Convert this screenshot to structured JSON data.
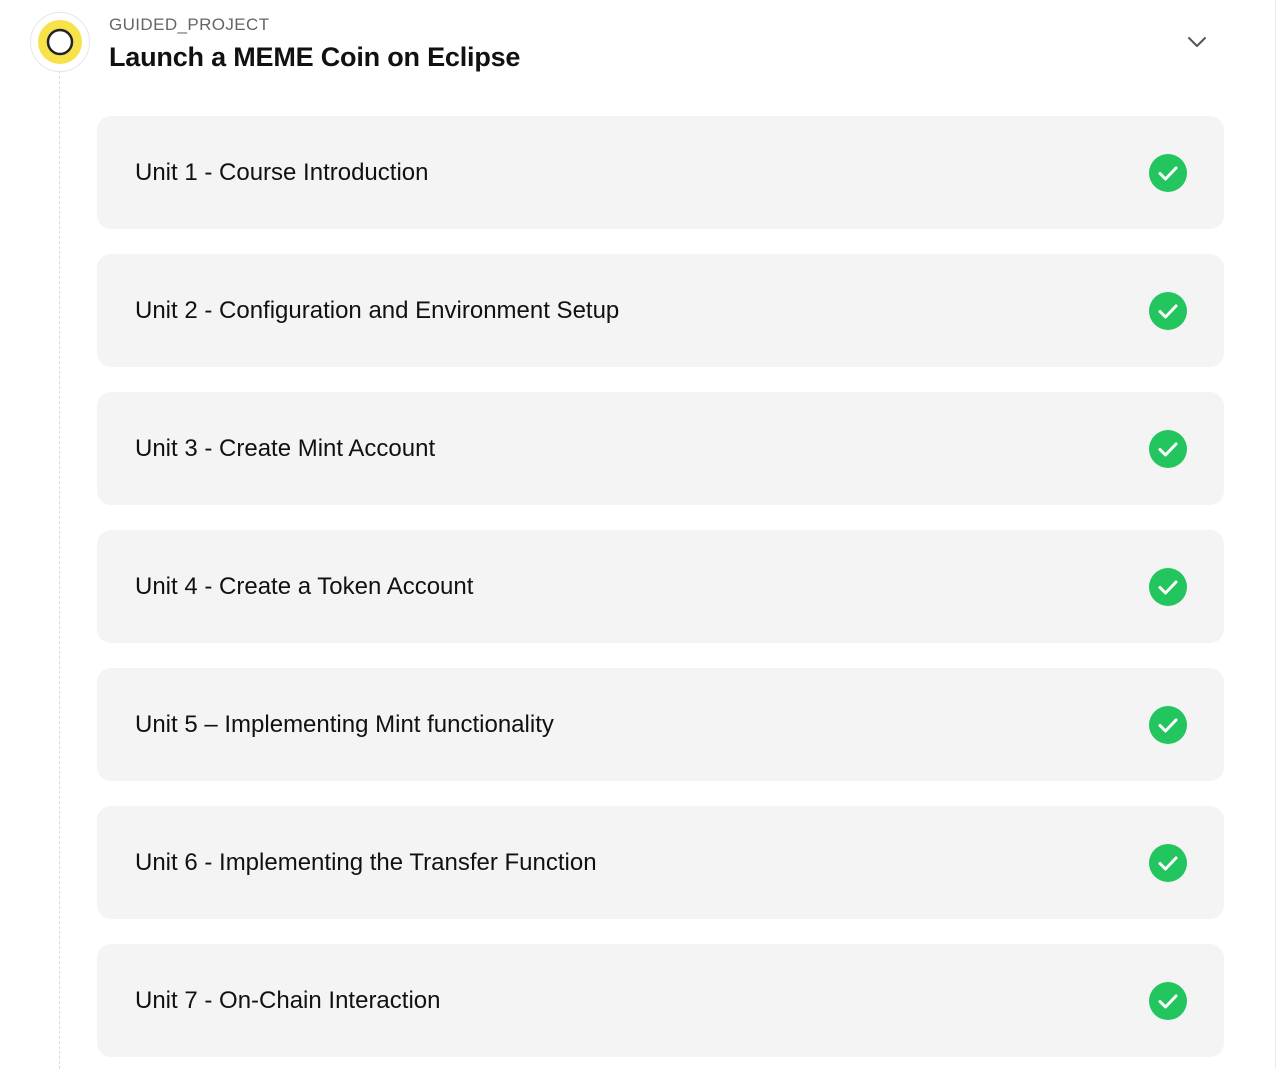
{
  "header": {
    "eyebrow": "GUIDED_PROJECT",
    "title": "Launch a MEME Coin on Eclipse",
    "status_icon": "ring-icon",
    "toggle_icon": "chevron-down-icon"
  },
  "units": [
    {
      "label": "Unit 1 - Course Introduction",
      "completed": true
    },
    {
      "label": "Unit 2 - Configuration and Environment Setup",
      "completed": true
    },
    {
      "label": "Unit 3 - Create Mint Account",
      "completed": true
    },
    {
      "label": "Unit 4 - Create a Token Account",
      "completed": true
    },
    {
      "label": "Unit 5 – Implementing Mint functionality",
      "completed": true
    },
    {
      "label": "Unit 6 - Implementing the Transfer Function",
      "completed": true
    },
    {
      "label": "Unit 7 - On-Chain Interaction",
      "completed": true
    }
  ],
  "colors": {
    "accent_yellow": "#f7e24a",
    "check_green": "#22c55e",
    "card_bg": "#f4f4f4"
  }
}
